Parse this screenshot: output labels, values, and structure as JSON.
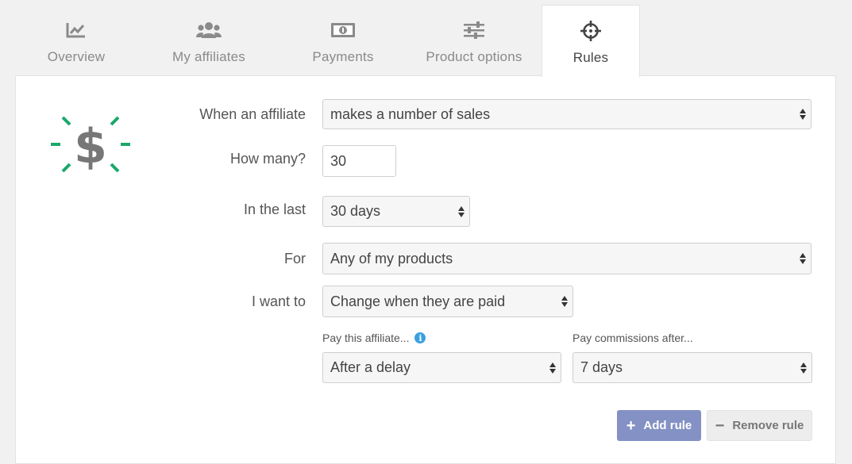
{
  "tabs": [
    {
      "label": "Overview",
      "icon": "chart-line-icon"
    },
    {
      "label": "My affiliates",
      "icon": "users-icon"
    },
    {
      "label": "Payments",
      "icon": "money-bill-icon"
    },
    {
      "label": "Product options",
      "icon": "sliders-icon"
    },
    {
      "label": "Rules",
      "icon": "crosshairs-icon",
      "active": true
    }
  ],
  "rule": {
    "logo_icon": "dollar-sparkle-icon",
    "when_label": "When an affiliate",
    "when_value": "makes a number of sales",
    "how_many_label": "How many?",
    "how_many_value": "30",
    "in_last_label": "In the last",
    "in_last_value": "30 days",
    "for_label": "For",
    "for_value": "Any of my products",
    "want_label": "I want to",
    "want_value": "Change when they are paid",
    "pay_affiliate_label": "Pay this affiliate...",
    "pay_affiliate_value": "After a delay",
    "pay_commissions_label": "Pay commissions after...",
    "pay_commissions_value": "7 days"
  },
  "actions": {
    "add_label": "Add rule",
    "remove_label": "Remove rule"
  },
  "colors": {
    "accent_button": "#8491c4",
    "logo_green": "#1aa86a",
    "info_blue": "#3aa0e0"
  }
}
